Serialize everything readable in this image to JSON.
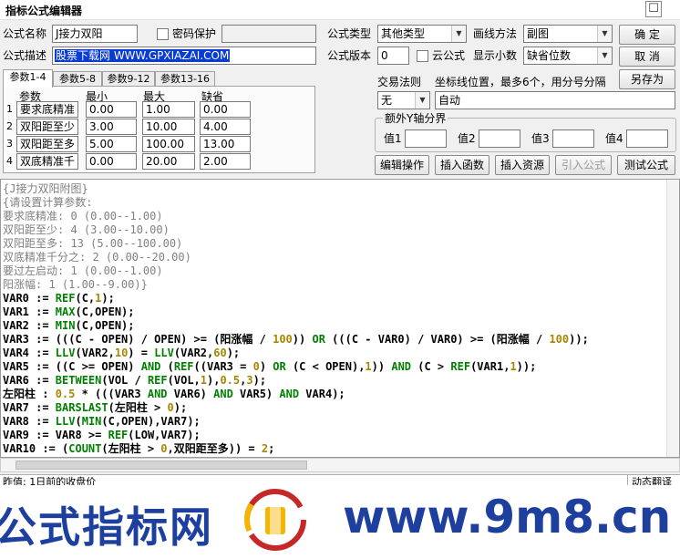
{
  "window": {
    "title": "指标公式编辑器",
    "close": "☐"
  },
  "form": {
    "name_label": "公式名称",
    "name_value": "J接力双阳",
    "password_label": "密码保护",
    "desc_label": "公式描述",
    "desc_value": "股票下载网 WWW.GPXIAZAI.COM",
    "type_label": "公式类型",
    "type_value": "其他类型",
    "draw_label": "画线方法",
    "draw_value": "副图",
    "version_label": "公式版本",
    "version_value": "0",
    "cloud_label": "云公式",
    "decimal_label": "显示小数",
    "decimal_value": "缺省位数"
  },
  "buttons": {
    "ok": "确  定",
    "cancel": "取  消",
    "save_as": "另存为"
  },
  "tabs": [
    "参数1-4",
    "参数5-8",
    "参数9-12",
    "参数13-16"
  ],
  "params": {
    "headers": [
      "参数",
      "最小",
      "最大",
      "缺省"
    ],
    "rows": [
      {
        "idx": "1",
        "name": "要求底精准",
        "min": "0.00",
        "max": "1.00",
        "def": "0.00"
      },
      {
        "idx": "2",
        "name": "双阳距至少",
        "min": "3.00",
        "max": "10.00",
        "def": "4.00"
      },
      {
        "idx": "3",
        "name": "双阳距至多",
        "min": "5.00",
        "max": "100.00",
        "def": "13.00"
      },
      {
        "idx": "4",
        "name": "双底精准千",
        "min": "0.00",
        "max": "20.00",
        "def": "2.00"
      }
    ]
  },
  "trade": {
    "label": "交易法则",
    "value": "无"
  },
  "coord": {
    "label": "坐标线位置，最多6个，用分号分隔",
    "value": "自动"
  },
  "yaxis": {
    "label": "额外Y轴分界",
    "v1": "值1",
    "v2": "值2",
    "v3": "值3",
    "v4": "值4"
  },
  "actions": {
    "edit": "编辑操作",
    "insert_fn": "插入函数",
    "insert_res": "插入资源",
    "import": "引入公式",
    "test": "测试公式"
  },
  "code_lines": [
    [
      [
        "c-cm",
        "{J接力双阳附图}"
      ]
    ],
    [
      [
        "c-cm",
        "{请设置计算参数:"
      ]
    ],
    [
      [
        "c-cm",
        "要求底精准: 0 (0.00--1.00)"
      ]
    ],
    [
      [
        "c-cm",
        "双阳距至少: 4 (3.00--10.00)"
      ]
    ],
    [
      [
        "c-cm",
        "双阳距至多: 13 (5.00--100.00)"
      ]
    ],
    [
      [
        "c-cm",
        "双底精准千分之: 2 (0.00--20.00)"
      ]
    ],
    [
      [
        "c-cm",
        "要过左启动: 1 (0.00--1.00)"
      ]
    ],
    [
      [
        "c-cm",
        "阳涨幅: 1 (1.00--9.00)}"
      ]
    ],
    [
      [
        "c-def",
        "VAR0 := "
      ],
      [
        "c-fn",
        "REF"
      ],
      [
        "c-def",
        "(C,"
      ],
      [
        "c-num",
        "1"
      ],
      [
        "c-def",
        ");"
      ]
    ],
    [
      [
        "c-def",
        "VAR1 := "
      ],
      [
        "c-fn",
        "MAX"
      ],
      [
        "c-def",
        "(C,OPEN);"
      ]
    ],
    [
      [
        "c-def",
        "VAR2 := "
      ],
      [
        "c-fn",
        "MIN"
      ],
      [
        "c-def",
        "(C,OPEN);"
      ]
    ],
    [
      [
        "c-def",
        "VAR3 := (((C - OPEN) / OPEN) >= (阳涨幅 / "
      ],
      [
        "c-num",
        "100"
      ],
      [
        "c-def",
        ")) "
      ],
      [
        "c-kw",
        "OR"
      ],
      [
        "c-def",
        " (((C - VAR0) / VAR0) >= (阳涨幅 / "
      ],
      [
        "c-num",
        "100"
      ],
      [
        "c-def",
        "));"
      ]
    ],
    [
      [
        "c-def",
        "VAR4 := "
      ],
      [
        "c-fn",
        "LLV"
      ],
      [
        "c-def",
        "(VAR2,"
      ],
      [
        "c-num",
        "10"
      ],
      [
        "c-def",
        ") = "
      ],
      [
        "c-fn",
        "LLV"
      ],
      [
        "c-def",
        "(VAR2,"
      ],
      [
        "c-num",
        "60"
      ],
      [
        "c-def",
        ");"
      ]
    ],
    [
      [
        "c-def",
        "VAR5 := ((C >= OPEN) "
      ],
      [
        "c-kw",
        "AND"
      ],
      [
        "c-def",
        " ("
      ],
      [
        "c-fn",
        "REF"
      ],
      [
        "c-def",
        "((VAR3 = "
      ],
      [
        "c-num",
        "0"
      ],
      [
        "c-def",
        ") "
      ],
      [
        "c-kw",
        "OR"
      ],
      [
        "c-def",
        " (C < OPEN),"
      ],
      [
        "c-num",
        "1"
      ],
      [
        "c-def",
        ")) "
      ],
      [
        "c-kw",
        "AND"
      ],
      [
        "c-def",
        " (C > "
      ],
      [
        "c-fn",
        "REF"
      ],
      [
        "c-def",
        "(VAR1,"
      ],
      [
        "c-num",
        "1"
      ],
      [
        "c-def",
        "));"
      ]
    ],
    [
      [
        "c-def",
        "VAR6 := "
      ],
      [
        "c-fn",
        "BETWEEN"
      ],
      [
        "c-def",
        "(VOL / "
      ],
      [
        "c-fn",
        "REF"
      ],
      [
        "c-def",
        "(VOL,"
      ],
      [
        "c-num",
        "1"
      ],
      [
        "c-def",
        "),"
      ],
      [
        "c-num",
        "0.5"
      ],
      [
        "c-def",
        ","
      ],
      [
        "c-num",
        "3"
      ],
      [
        "c-def",
        ");"
      ]
    ],
    [
      [
        "c-def",
        "左阳柱 : "
      ],
      [
        "c-num",
        "0.5"
      ],
      [
        "c-def",
        " * (((VAR3 "
      ],
      [
        "c-kw",
        "AND"
      ],
      [
        "c-def",
        " VAR6) "
      ],
      [
        "c-kw",
        "AND"
      ],
      [
        "c-def",
        " VAR5) "
      ],
      [
        "c-kw",
        "AND"
      ],
      [
        "c-def",
        " VAR4);"
      ]
    ],
    [
      [
        "c-def",
        "VAR7 := "
      ],
      [
        "c-fn",
        "BARSLAST"
      ],
      [
        "c-def",
        "(左阳柱 > "
      ],
      [
        "c-num",
        "0"
      ],
      [
        "c-def",
        ");"
      ]
    ],
    [
      [
        "c-def",
        "VAR8 := "
      ],
      [
        "c-fn",
        "LLV"
      ],
      [
        "c-def",
        "("
      ],
      [
        "c-fn",
        "MIN"
      ],
      [
        "c-def",
        "(C,OPEN),VAR7);"
      ]
    ],
    [
      [
        "c-def",
        "VAR9 := VAR8 >= "
      ],
      [
        "c-fn",
        "REF"
      ],
      [
        "c-def",
        "(LOW,VAR7);"
      ]
    ],
    [
      [
        "c-def",
        "VAR10 := ("
      ],
      [
        "c-fn",
        "COUNT"
      ],
      [
        "c-def",
        "(左阳柱 > "
      ],
      [
        "c-num",
        "0"
      ],
      [
        "c-def",
        ",双阳距至多)) = "
      ],
      [
        "c-num",
        "2"
      ],
      [
        "c-def",
        ";"
      ]
    ]
  ],
  "status": {
    "text": "昨值: 1日前的收盘价",
    "right": "动态翻译"
  },
  "watermark": {
    "left": "公式指标网",
    "right": "www.9m8.cn"
  }
}
